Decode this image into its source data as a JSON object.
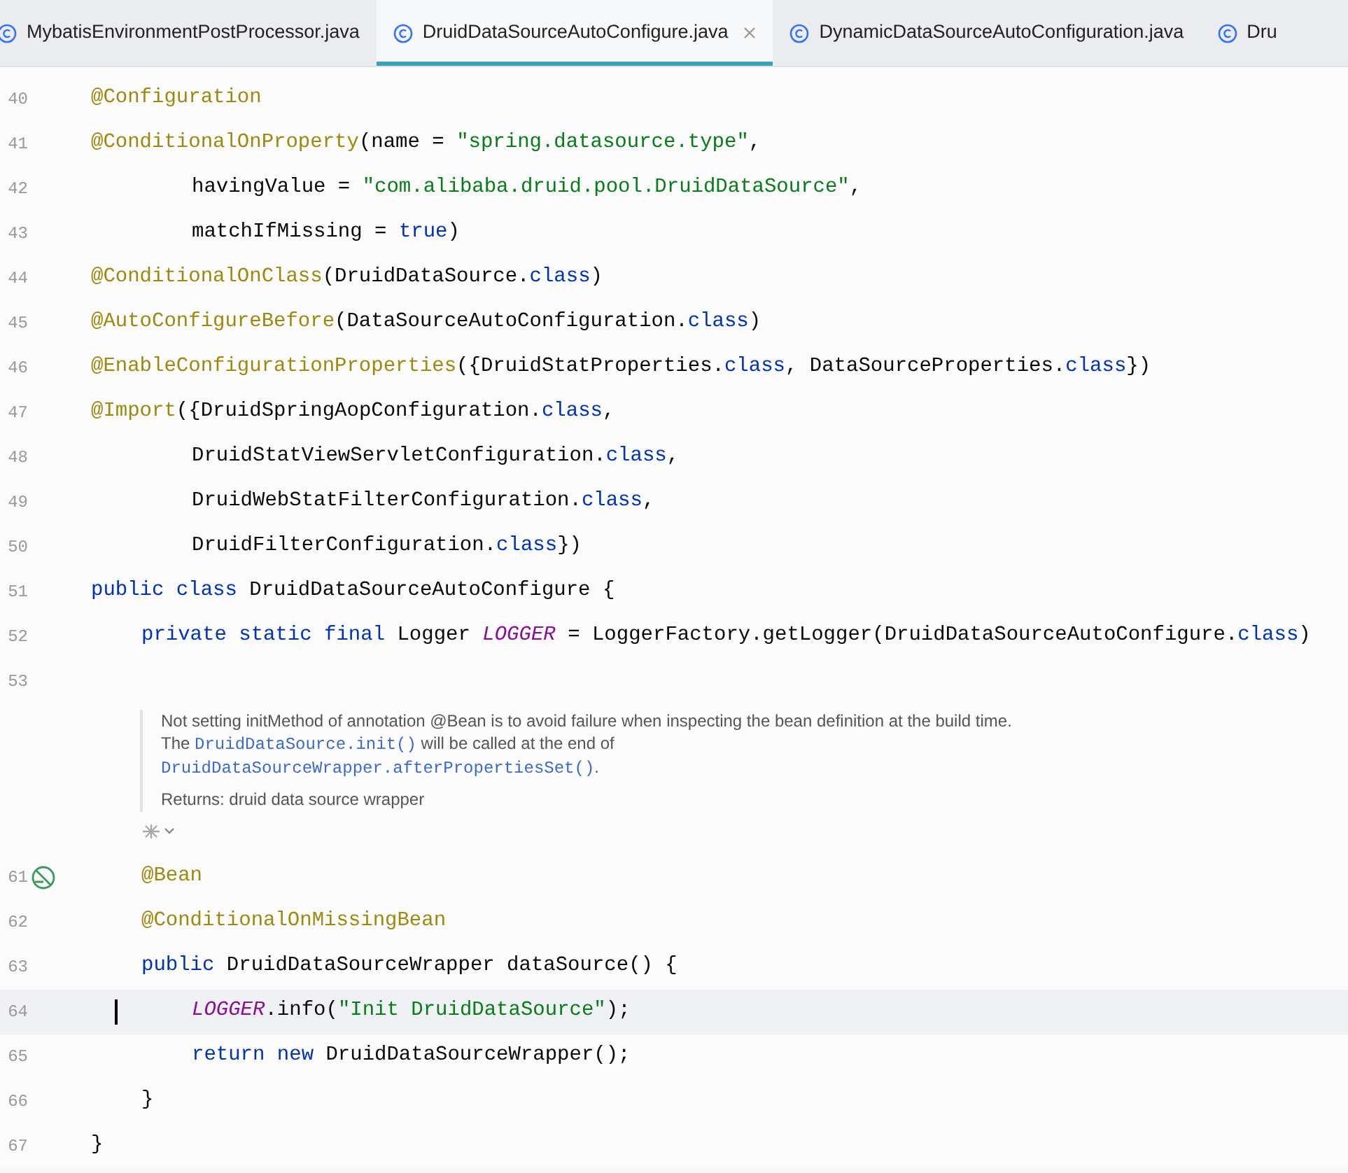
{
  "tabs": [
    {
      "label": "MybatisEnvironmentPostProcessor.java",
      "selected": false,
      "closable": false
    },
    {
      "label": "DruidDataSourceAutoConfigure.java",
      "selected": true,
      "closable": true
    },
    {
      "label": "DynamicDataSourceAutoConfiguration.java",
      "selected": false,
      "closable": false
    },
    {
      "label": "Dru",
      "selected": false,
      "closable": false
    }
  ],
  "editor": {
    "lines": [
      {
        "number": "40",
        "kind": "top",
        "tokens": [
          {
            "kind": "annotation",
            "t": "@Configuration"
          }
        ]
      },
      {
        "number": "41",
        "kind": "top",
        "tokens": [
          {
            "kind": "annotation",
            "t": "@ConditionalOnProperty"
          },
          {
            "kind": "plain",
            "t": "(name = "
          },
          {
            "kind": "string",
            "t": "\"spring.datasource.type\""
          },
          {
            "kind": "plain",
            "t": ","
          }
        ]
      },
      {
        "number": "42",
        "kind": "continuation",
        "tokens": [
          {
            "kind": "plain",
            "t": "havingValue = "
          },
          {
            "kind": "string",
            "t": "\"com.alibaba.druid.pool.DruidDataSource\""
          },
          {
            "kind": "plain",
            "t": ","
          }
        ]
      },
      {
        "number": "43",
        "kind": "continuation",
        "tokens": [
          {
            "kind": "plain",
            "t": "matchIfMissing = "
          },
          {
            "kind": "keyword",
            "t": "true"
          },
          {
            "kind": "plain",
            "t": ")"
          }
        ]
      },
      {
        "number": "44",
        "kind": "top",
        "tokens": [
          {
            "kind": "annotation",
            "t": "@ConditionalOnClass"
          },
          {
            "kind": "plain",
            "t": "(DruidDataSource."
          },
          {
            "kind": "keyword",
            "t": "class"
          },
          {
            "kind": "plain",
            "t": ")"
          }
        ]
      },
      {
        "number": "45",
        "kind": "top",
        "tokens": [
          {
            "kind": "annotation",
            "t": "@AutoConfigureBefore"
          },
          {
            "kind": "plain",
            "t": "(DataSourceAutoConfiguration."
          },
          {
            "kind": "keyword",
            "t": "class"
          },
          {
            "kind": "plain",
            "t": ")"
          }
        ]
      },
      {
        "number": "46",
        "kind": "top",
        "tokens": [
          {
            "kind": "annotation",
            "t": "@EnableConfigurationProperties"
          },
          {
            "kind": "plain",
            "t": "({DruidStatProperties."
          },
          {
            "kind": "keyword",
            "t": "class"
          },
          {
            "kind": "plain",
            "t": ", DataSourceProperties."
          },
          {
            "kind": "keyword",
            "t": "class"
          },
          {
            "kind": "plain",
            "t": "})"
          }
        ]
      },
      {
        "number": "47",
        "kind": "top",
        "tokens": [
          {
            "kind": "annotation",
            "t": "@Import"
          },
          {
            "kind": "plain",
            "t": "({DruidSpringAopConfiguration."
          },
          {
            "kind": "keyword",
            "t": "class"
          },
          {
            "kind": "plain",
            "t": ","
          }
        ]
      },
      {
        "number": "48",
        "kind": "continuation",
        "tokens": [
          {
            "kind": "plain",
            "t": "DruidStatViewServletConfiguration."
          },
          {
            "kind": "keyword",
            "t": "class"
          },
          {
            "kind": "plain",
            "t": ","
          }
        ]
      },
      {
        "number": "49",
        "kind": "continuation",
        "tokens": [
          {
            "kind": "plain",
            "t": "DruidWebStatFilterConfiguration."
          },
          {
            "kind": "keyword",
            "t": "class"
          },
          {
            "kind": "plain",
            "t": ","
          }
        ]
      },
      {
        "number": "50",
        "kind": "continuation",
        "tokens": [
          {
            "kind": "plain",
            "t": "DruidFilterConfiguration."
          },
          {
            "kind": "keyword",
            "t": "class"
          },
          {
            "kind": "plain",
            "t": "})"
          }
        ]
      },
      {
        "number": "51",
        "kind": "top",
        "tokens": [
          {
            "kind": "keyword",
            "t": "public class"
          },
          {
            "kind": "plain",
            "t": " DruidDataSourceAutoConfigure {"
          }
        ]
      },
      {
        "number": "52",
        "kind": "member",
        "tokens": [
          {
            "kind": "keyword",
            "t": "private static final"
          },
          {
            "kind": "plain",
            "t": " Logger "
          },
          {
            "kind": "field",
            "t": "LOGGER"
          },
          {
            "kind": "plain",
            "t": " = LoggerFactory.getLogger(DruidDataSourceAutoConfigure."
          },
          {
            "kind": "keyword",
            "t": "class"
          },
          {
            "kind": "plain",
            "t": ")"
          }
        ]
      },
      {
        "number": "53",
        "kind": "top"
      },
      {
        "kind": "doc",
        "paragraph": [
          {
            "kind": "text",
            "t": "Not setting initMethod of annotation @Bean is to avoid failure when inspecting the bean definition at the build time. The "
          },
          {
            "kind": "code",
            "t": "DruidDataSource.init()"
          },
          {
            "kind": "text",
            "t": " will be called at the end of "
          },
          {
            "kind": "code",
            "t": "DruidDataSourceWrapper.afterPropertiesSet()"
          },
          {
            "kind": "text",
            "t": "."
          }
        ],
        "returns": "Returns: druid data source wrapper"
      },
      {
        "number": "61",
        "kind": "member",
        "gutter_marker": true,
        "tokens": [
          {
            "kind": "annotation",
            "t": "@Bean"
          }
        ]
      },
      {
        "number": "62",
        "kind": "member",
        "tokens": [
          {
            "kind": "annotation",
            "t": "@ConditionalOnMissingBean"
          }
        ]
      },
      {
        "number": "63",
        "kind": "member",
        "tokens": [
          {
            "kind": "keyword",
            "t": "public"
          },
          {
            "kind": "plain",
            "t": " DruidDataSourceWrapper dataSource() {"
          }
        ]
      },
      {
        "number": "64",
        "kind": "body",
        "current": true,
        "tokens": [
          {
            "kind": "field",
            "t": "LOGGER"
          },
          {
            "kind": "plain",
            "t": ".info("
          },
          {
            "kind": "string",
            "t": "\"Init DruidDataSource\""
          },
          {
            "kind": "plain",
            "t": ");"
          }
        ]
      },
      {
        "number": "65",
        "kind": "body",
        "current": false,
        "tokens": [
          {
            "kind": "keyword",
            "t": "return new"
          },
          {
            "kind": "plain",
            "t": " DruidDataSourceWrapper();"
          }
        ]
      },
      {
        "number": "66",
        "kind": "member",
        "tokens": [
          {
            "kind": "plain",
            "t": "}"
          }
        ]
      },
      {
        "number": "67",
        "kind": "top",
        "tokens": [
          {
            "kind": "plain",
            "t": "}"
          }
        ]
      }
    ]
  }
}
